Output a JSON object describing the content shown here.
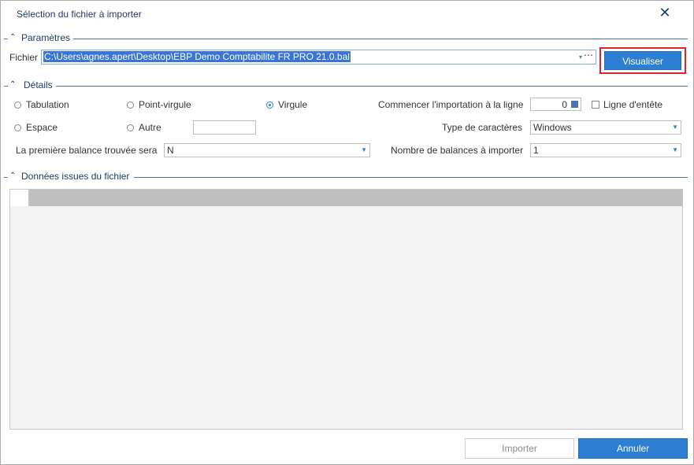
{
  "window": {
    "title": "Sélection du fichier à importer",
    "close_icon": "close-icon"
  },
  "parametres": {
    "label": "Paramètres",
    "file_label": "Fichier",
    "file_value": "C:\\Users\\agnes.apert\\Desktop\\EBP Demo Comptabilite FR PRO 21.0.bal",
    "dropdown_icon": "▾",
    "browse_icon": "⋯",
    "visualiser_label": "Visualiser"
  },
  "details": {
    "label": "Détails",
    "radio_tabulation": "Tabulation",
    "radio_point_virgule": "Point-virgule",
    "radio_virgule": "Virgule",
    "radio_espace": "Espace",
    "radio_autre": "Autre",
    "selected_separator": "Virgule",
    "autre_value": "",
    "start_line_label": "Commencer l'importation à la ligne",
    "start_line_value": "0",
    "header_line_label": "Ligne d'entête",
    "header_line_checked": false,
    "charset_label": "Type de caractères",
    "charset_value": "Windows",
    "first_balance_label": "La première balance trouvée sera",
    "first_balance_value": "N",
    "balance_count_label": "Nombre de balances à importer",
    "balance_count_value": "1"
  },
  "donnees": {
    "label": "Données issues du fichier"
  },
  "footer": {
    "import_label": "Importer",
    "cancel_label": "Annuler"
  },
  "colors": {
    "accent": "#2d7fd3",
    "highlight_border": "#e0232a",
    "group_line": "#4a73b8"
  }
}
